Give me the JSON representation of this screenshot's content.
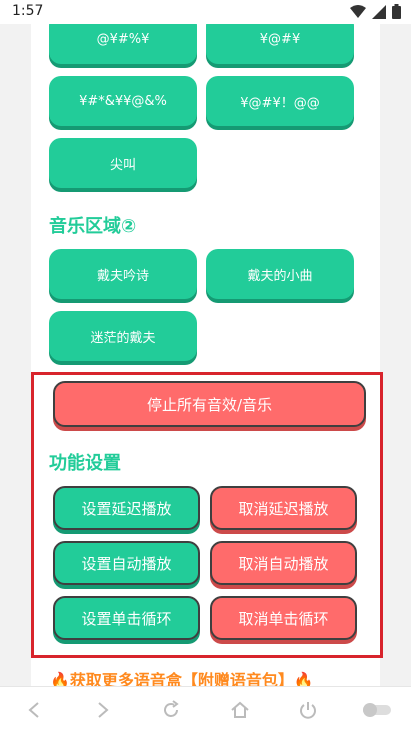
{
  "status": {
    "time": "1:57"
  },
  "effects": {
    "b1": "@¥#%¥",
    "b2": "¥@#¥",
    "b3": "¥#*&¥¥@&%",
    "b4": "¥@#¥！@@",
    "b5": "尖叫"
  },
  "music": {
    "heading": "音乐区域②",
    "b1": "戴夫吟诗",
    "b2": "戴夫的小曲",
    "b3": "迷茫的戴夫"
  },
  "controls": {
    "stop_all": "停止所有音效/音乐",
    "heading": "功能设置",
    "set_delay": "设置延迟播放",
    "cancel_delay": "取消延迟播放",
    "set_auto": "设置自动播放",
    "cancel_auto": "取消自动播放",
    "set_loop": "设置单击循环",
    "cancel_loop": "取消单击循环"
  },
  "promo": {
    "text": "🔥获取更多语音盒【附赠语音包】🔥"
  },
  "colors": {
    "green": "#22cc99",
    "red": "#ff6b6b",
    "highlight": "#d8242c",
    "promo": "#ff8a1f"
  }
}
